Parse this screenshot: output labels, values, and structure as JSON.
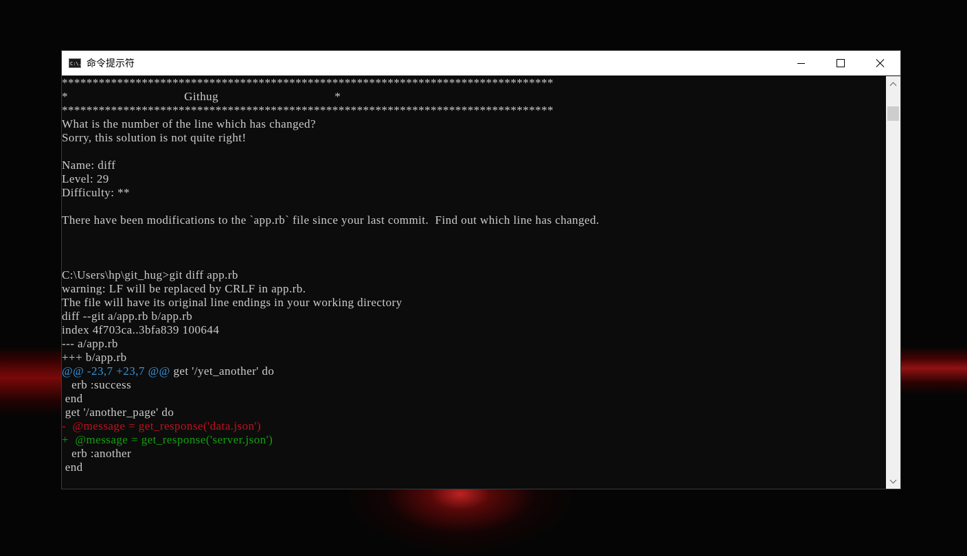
{
  "window": {
    "title": "命令提示符",
    "icon": "cmd-icon",
    "icon_text": "C:\\."
  },
  "controls": {
    "minimize": "minimize-icon",
    "maximize": "maximize-icon",
    "close": "close-icon"
  },
  "colors": {
    "console_bg": "#0c0c0c",
    "console_fg": "#cccccc",
    "hunk_header": "#3a96dd",
    "removed": "#c50f1f",
    "added": "#13a10e"
  },
  "console": {
    "banner_top": "********************************************************************************",
    "banner_title": "*                                    Githug                                    *",
    "banner_bottom": "********************************************************************************",
    "question": "What is the number of the line which has changed?",
    "feedback": "Sorry, this solution is not quite right!",
    "blank1": "",
    "name": "Name: diff",
    "level": "Level: 29",
    "difficulty": "Difficulty: **",
    "blank2": "",
    "description": "There have been modifications to the `app.rb` file since your last commit.  Find out which line has changed.",
    "blank3": "",
    "blank4": "",
    "blank5": "",
    "command": "C:\\Users\\hp\\git_hug>git diff app.rb",
    "warning1": "warning: LF will be replaced by CRLF in app.rb.",
    "warning2": "The file will have its original line endings in your working directory",
    "diff_header": "diff --git a/app.rb b/app.rb",
    "index_line": "index 4f703ca..3bfa839 100644",
    "old_file": "--- a/app.rb",
    "new_file": "+++ b/app.rb",
    "hunk_marker": "@@ -23,7 +23,7 @@",
    "hunk_context": " get '/yet_another' do",
    "ctx1": "   erb :success",
    "ctx2": " end",
    "ctx3": " get '/another_page' do",
    "removed_line": "-  @message = get_response('data.json')",
    "added_line": "+  @message = get_response('server.json')",
    "ctx4": "   erb :another",
    "ctx5": " end"
  }
}
